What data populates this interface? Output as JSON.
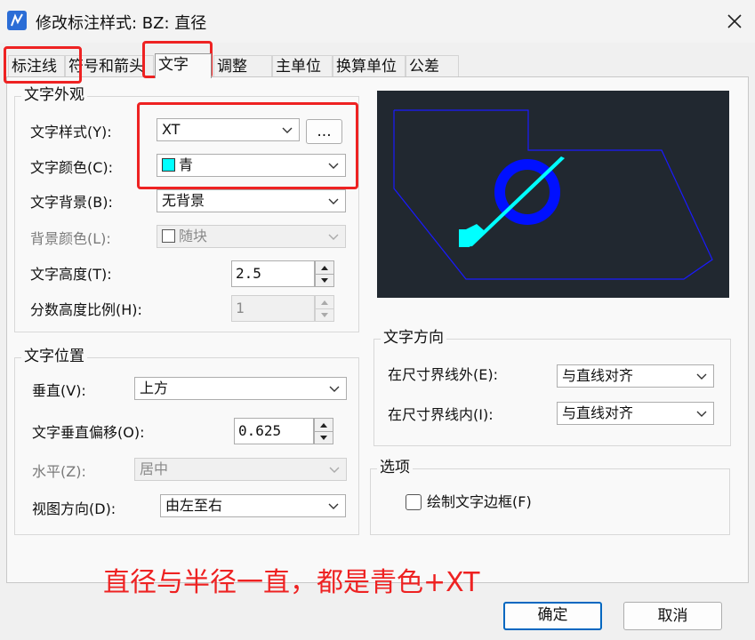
{
  "window": {
    "title": "修改标注样式: BZ: 直径"
  },
  "tabs": [
    {
      "label": "标注线"
    },
    {
      "label": "符号和箭头"
    },
    {
      "label": "文字"
    },
    {
      "label": "调整"
    },
    {
      "label": "主单位"
    },
    {
      "label": "换算单位"
    },
    {
      "label": "公差"
    }
  ],
  "appearance": {
    "title": "文字外观",
    "style_label": "文字样式(Y):",
    "style_value": "XT",
    "style_browse": "...",
    "color_label": "文字颜色(C):",
    "color_value": "青",
    "color_swatch": "#00ffff",
    "bg_label": "文字背景(B):",
    "bg_value": "无背景",
    "bgcolor_label": "背景颜色(L):",
    "bgcolor_value": "随块",
    "height_label": "文字高度(T):",
    "height_value": "2.5",
    "fraction_label": "分数高度比例(H):",
    "fraction_value": "1"
  },
  "position": {
    "title": "文字位置",
    "vertical_label": "垂直(V):",
    "vertical_value": "上方",
    "offset_label": "文字垂直偏移(O):",
    "offset_value": "0.625",
    "horizontal_label": "水平(Z):",
    "horizontal_value": "居中",
    "view_label": "视图方向(D):",
    "view_value": "由左至右"
  },
  "direction": {
    "title": "文字方向",
    "outside_label": "在尺寸界线外(E):",
    "outside_value": "与直线对齐",
    "inside_label": "在尺寸界线内(I):",
    "inside_value": "与直线对齐"
  },
  "options": {
    "title": "选项",
    "frame_label": "绘制文字边框(F)"
  },
  "note": "直径与半径一直，都是青色+XT",
  "buttons": {
    "ok": "确定",
    "cancel": "取消"
  },
  "colors": {
    "highlight": "#ee2222",
    "preview_bg": "#212830",
    "preview_blue": "#0000ff",
    "preview_cyan": "#00ffff"
  }
}
